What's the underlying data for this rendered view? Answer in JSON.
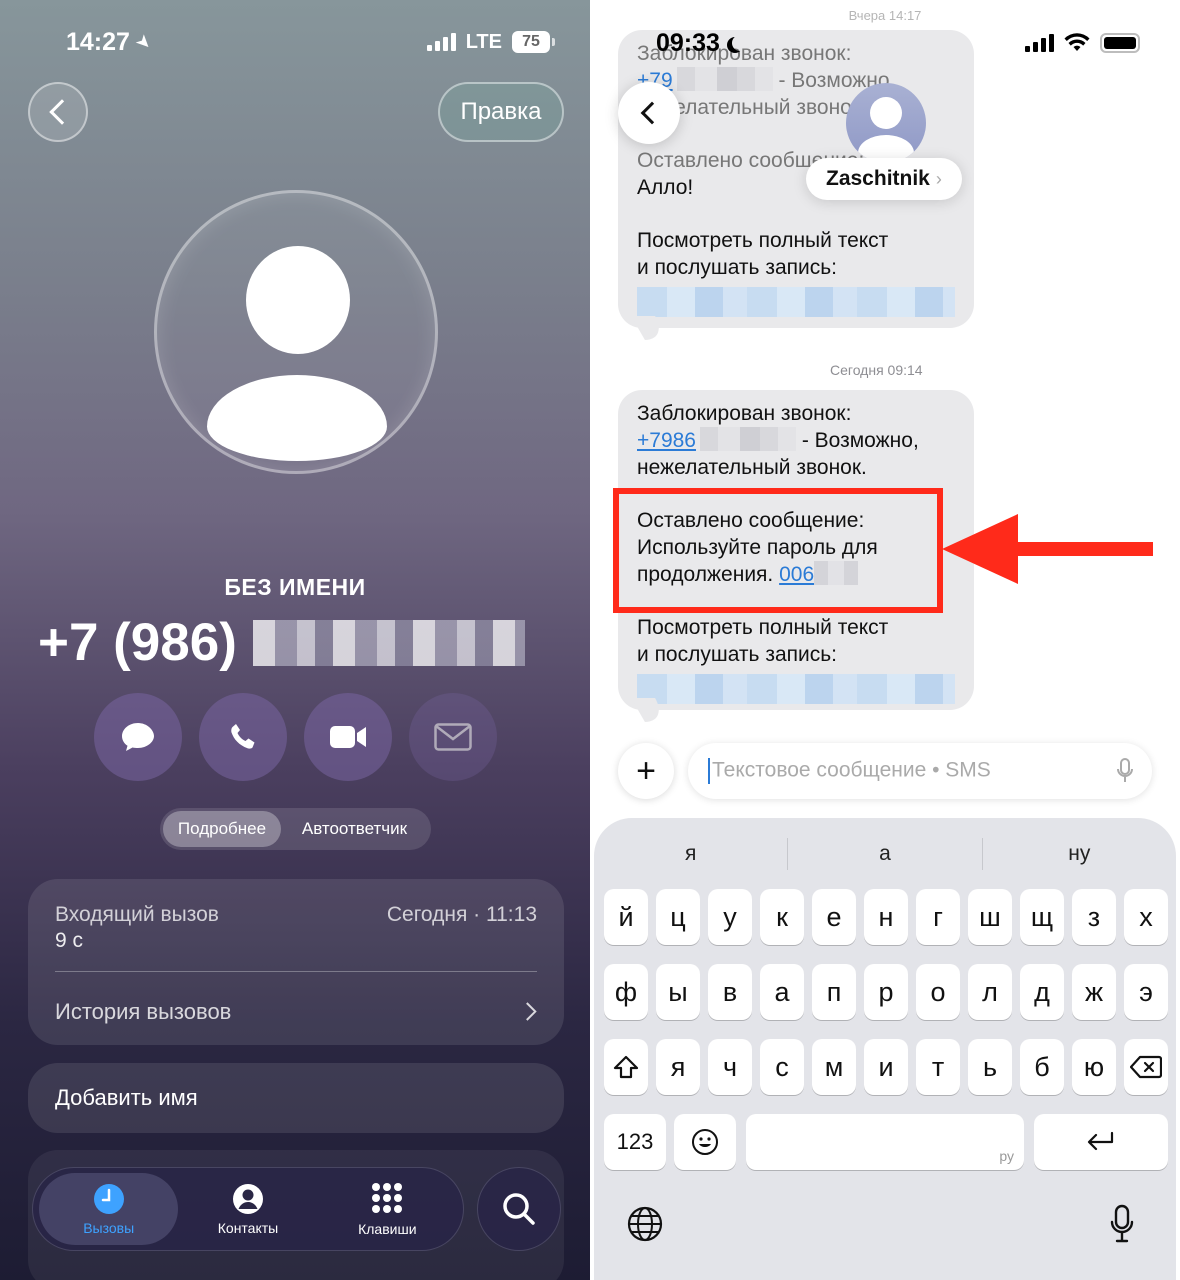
{
  "left": {
    "status_time": "14:27",
    "network": "LTE",
    "battery": "75",
    "edit_label": "Правка",
    "contact_label": "БЕЗ ИМЕНИ",
    "phone_prefix": "+7 (986)",
    "segment": {
      "details": "Подробнее",
      "voicemail": "Автоответчик"
    },
    "call": {
      "type": "Входящий вызов",
      "time": "Сегодня · 11:13",
      "duration": "9 с",
      "history": "История вызовов"
    },
    "add_name": "Добавить имя",
    "tabs": [
      {
        "label": "Вызовы",
        "icon": "clock-icon"
      },
      {
        "label": "Контакты",
        "icon": "person-icon"
      },
      {
        "label": "Клавиши",
        "icon": "keypad-icon"
      }
    ]
  },
  "right": {
    "top_timestamp": "Вчера 14:17",
    "status_time": "09:33",
    "contact_name": "Zaschitnik",
    "bubble1": {
      "line1": "Заблокирован звонок:",
      "line2_prefix": "+79",
      "line2_suffix": "- Возможно,",
      "line3": "нежелательный звонок.",
      "left_msg": "Оставлено сообщение:",
      "allo": "Алло!",
      "view1": "Посмотреть полный текст",
      "view2": "и послушать запись:"
    },
    "timestamp2": "Сегодня 09:14",
    "bubble2": {
      "line1": "Заблокирован звонок:",
      "phone_link": "+7986",
      "line2_suffix": "- Возможно,",
      "line3": "нежелательный звонок.",
      "left_msg": "Оставлено сообщение:",
      "msg2": "Используйте пароль для",
      "msg3_prefix": "продолжения.",
      "code_link": "006",
      "view1": "Посмотреть полный текст",
      "view2": "и послушать запись:"
    },
    "input_placeholder": "Текстовое сообщение • SMS",
    "keyboard": {
      "suggestions": [
        "я",
        "а",
        "ну"
      ],
      "row1": [
        "й",
        "ц",
        "у",
        "к",
        "е",
        "н",
        "г",
        "ш",
        "щ",
        "з",
        "х"
      ],
      "row2": [
        "ф",
        "ы",
        "в",
        "а",
        "п",
        "р",
        "о",
        "л",
        "д",
        "ж",
        "э"
      ],
      "row3": [
        "я",
        "ч",
        "с",
        "м",
        "и",
        "т",
        "ь",
        "б",
        "ю"
      ],
      "numbers_key": "123",
      "space_lang": "ру"
    }
  },
  "colors": {
    "highlight_red": "#ff2a1a",
    "link_blue": "#2b7bd6",
    "tab_active": "#3ea2ff"
  }
}
